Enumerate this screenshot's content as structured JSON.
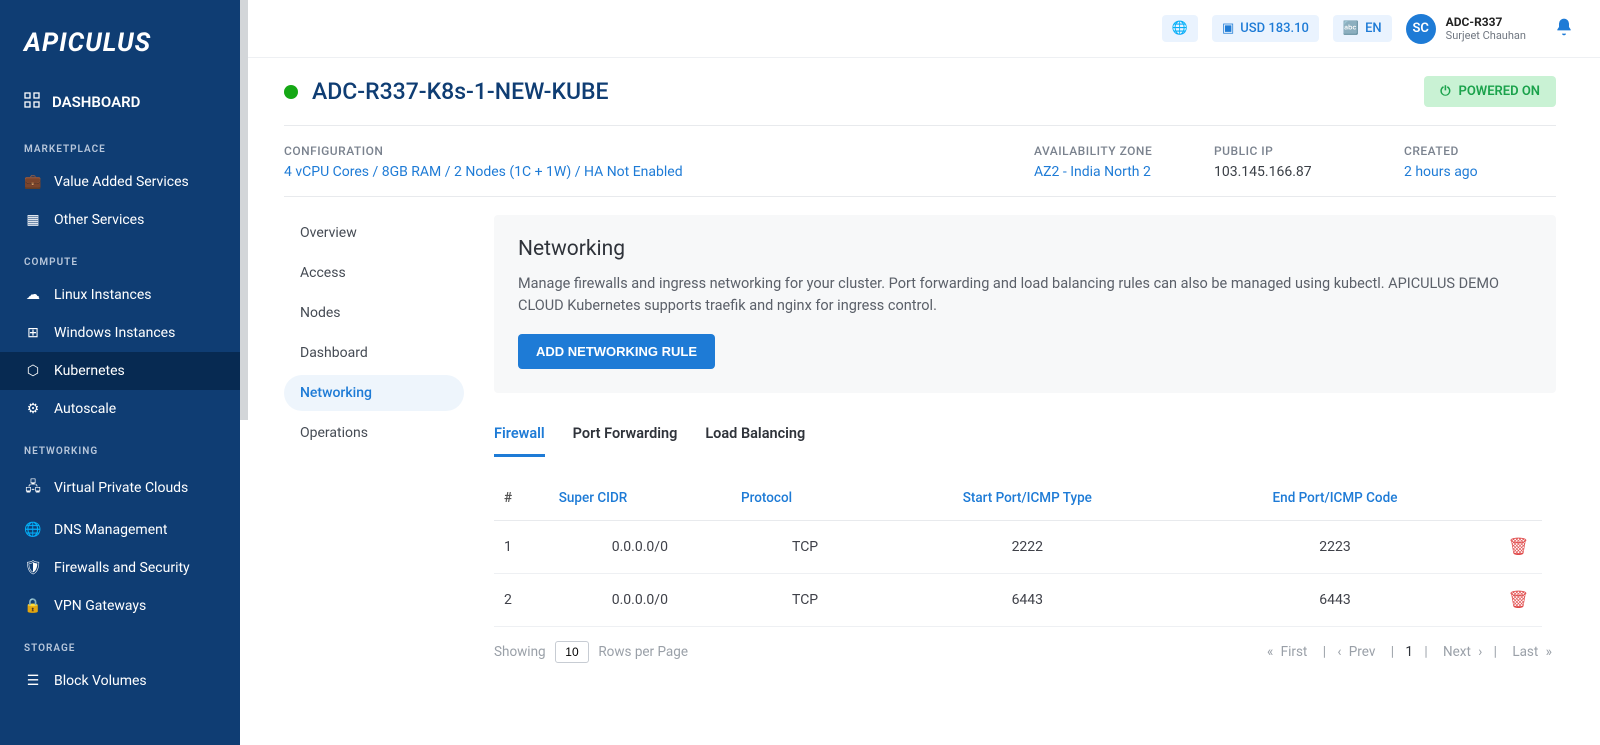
{
  "brand": "APICULUS",
  "topbar": {
    "balance": "USD 183.10",
    "language": "EN",
    "account_code": "ADC-R337",
    "account_name": "Surjeet Chauhan",
    "avatar_initials": "SC"
  },
  "sidebar": {
    "dashboard": "DASHBOARD",
    "sections": [
      {
        "label": "MARKETPLACE",
        "items": [
          "Value Added Services",
          "Other Services"
        ]
      },
      {
        "label": "COMPUTE",
        "items": [
          "Linux Instances",
          "Windows Instances",
          "Kubernetes",
          "Autoscale"
        ]
      },
      {
        "label": "NETWORKING",
        "items": [
          "Virtual Private Clouds",
          "DNS Management",
          "Firewalls and Security",
          "VPN Gateways"
        ]
      },
      {
        "label": "STORAGE",
        "items": [
          "Block Volumes"
        ]
      }
    ],
    "active": "Kubernetes"
  },
  "page": {
    "title": "ADC-R337-K8s-1-NEW-KUBE",
    "power_label": "POWERED ON",
    "meta": {
      "configuration_label": "CONFIGURATION",
      "configuration_value": "4 vCPU Cores / 8GB RAM / 2 Nodes (1C + 1W) / HA Not Enabled",
      "zone_label": "AVAILABILITY ZONE",
      "zone_value": "AZ2 - India North 2",
      "ip_label": "PUBLIC IP",
      "ip_value": "103.145.166.87",
      "created_label": "CREATED",
      "created_value": "2 hours ago"
    }
  },
  "subnav": [
    "Overview",
    "Access",
    "Nodes",
    "Dashboard",
    "Networking",
    "Operations"
  ],
  "subnav_active": "Networking",
  "networking": {
    "title": "Networking",
    "description": "Manage firewalls and ingress networking for your cluster. Port forwarding and load balancing rules can also be managed using kubectl. APICULUS DEMO CLOUD Kubernetes supports traefik and nginx for ingress control.",
    "add_button": "ADD NETWORKING RULE",
    "tabs": [
      "Firewall",
      "Port Forwarding",
      "Load Balancing"
    ],
    "active_tab": "Firewall",
    "columns": {
      "hash": "#",
      "cidr": "Super CIDR",
      "protocol": "Protocol",
      "start": "Start Port/ICMP Type",
      "end": "End Port/ICMP Code"
    },
    "rows": [
      {
        "n": "1",
        "cidr": "0.0.0.0/0",
        "protocol": "TCP",
        "start": "2222",
        "end": "2223"
      },
      {
        "n": "2",
        "cidr": "0.0.0.0/0",
        "protocol": "TCP",
        "start": "6443",
        "end": "6443"
      }
    ],
    "footer": {
      "showing": "Showing",
      "rows_value": "10",
      "rows_label": "Rows per Page",
      "first": "First",
      "prev": "Prev",
      "page": "1",
      "next": "Next",
      "last": "Last"
    }
  }
}
